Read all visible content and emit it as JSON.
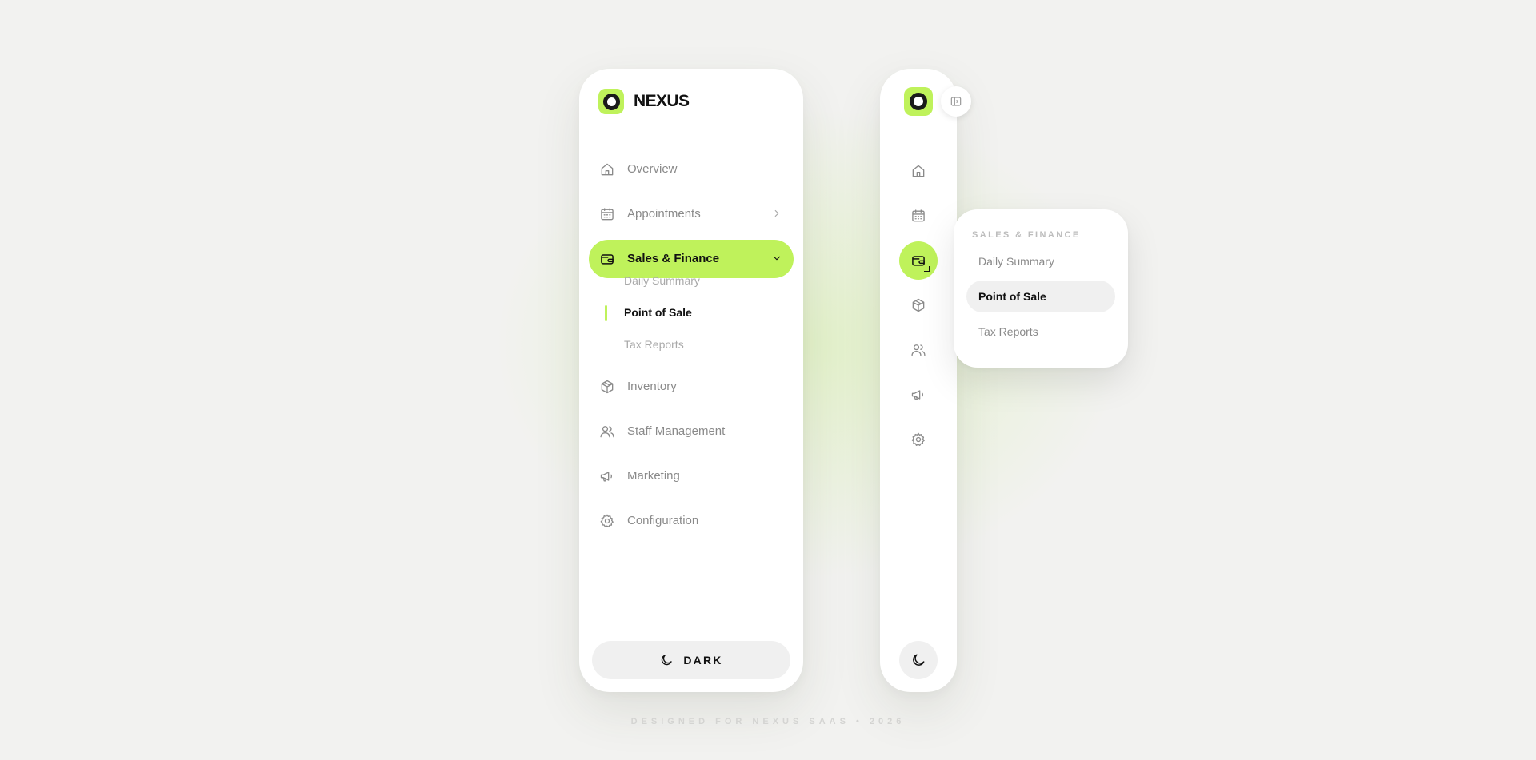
{
  "brand": {
    "name": "NEXUS"
  },
  "colors": {
    "accent": "#bff25b",
    "surface": "#ffffff",
    "background": "#f2f2f0",
    "text": "#111111",
    "muted": "#8a8a8a"
  },
  "sidebar": {
    "items": [
      {
        "label": "Overview",
        "icon": "home-icon"
      },
      {
        "label": "Appointments",
        "icon": "calendar-icon"
      },
      {
        "label": "Sales & Finance",
        "icon": "wallet-icon"
      },
      {
        "label": "Inventory",
        "icon": "box-icon"
      },
      {
        "label": "Staff Management",
        "icon": "users-icon"
      },
      {
        "label": "Marketing",
        "icon": "megaphone-icon"
      },
      {
        "label": "Configuration",
        "icon": "gear-icon"
      }
    ],
    "active_item": "Sales & Finance",
    "sub_items": [
      {
        "label": "Daily Summary"
      },
      {
        "label": "Point of Sale"
      },
      {
        "label": "Tax Reports"
      }
    ],
    "active_sub_item": "Point of Sale",
    "theme_button": {
      "label": "DARK",
      "icon": "moon-icon"
    }
  },
  "rail": {
    "toggle_icon": "sidebar-toggle-icon",
    "flyout": {
      "title": "SALES & FINANCE",
      "items": [
        {
          "label": "Daily Summary"
        },
        {
          "label": "Point of Sale"
        },
        {
          "label": "Tax Reports"
        }
      ]
    }
  },
  "footer": {
    "text": "DESIGNED FOR NEXUS SAAS • 2026"
  }
}
